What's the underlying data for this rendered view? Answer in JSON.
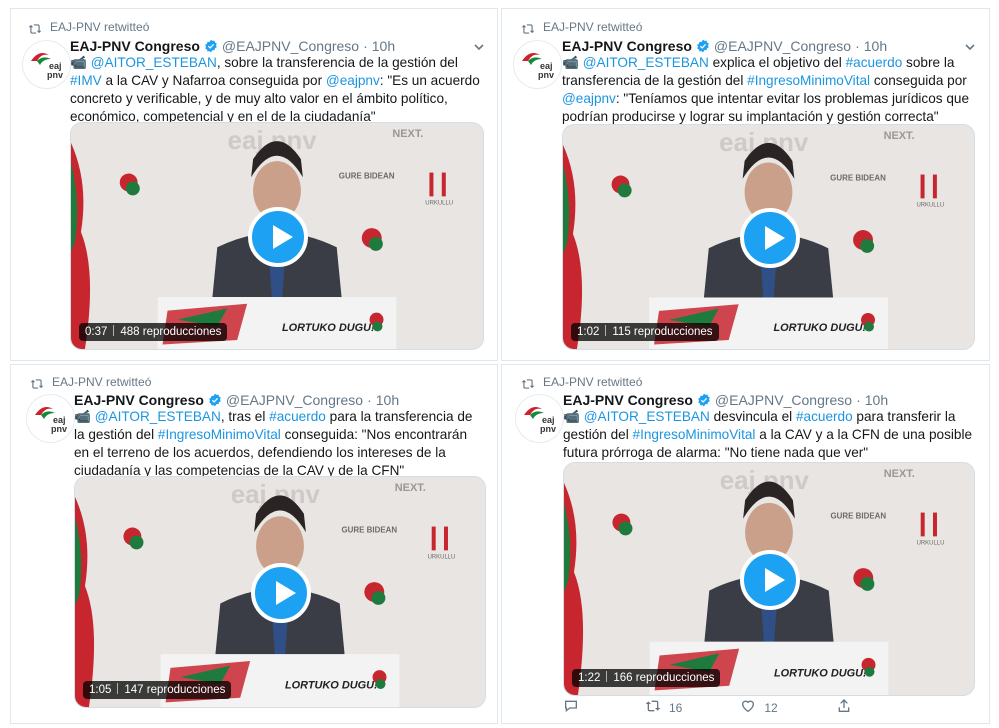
{
  "tweets": [
    {
      "retweeted_by": "EAJ-PNV retwitteó",
      "author": {
        "name": "EAJ-PNV Congreso",
        "handle": "@EAJPNV_Congreso",
        "time": "10h"
      },
      "text": [
        {
          "t": "📹 ",
          "link": false
        },
        {
          "t": "@AITOR_ESTEBAN",
          "link": true
        },
        {
          "t": ", sobre la transferencia de la gestión del ",
          "link": false
        },
        {
          "t": "#IMV",
          "link": true
        },
        {
          "t": " a la CAV y Nafarroa conseguida por ",
          "link": false
        },
        {
          "t": "@eajpnv",
          "link": true
        },
        {
          "t": ": \"Es un acuerdo concreto y verificable, y de muy alto valor en el ámbito político, económico, competencial y en el de la ciudadanía\"",
          "link": false
        }
      ],
      "video": {
        "duration": "0:37",
        "views": "488 reproducciones"
      }
    },
    {
      "retweeted_by": "EAJ-PNV retwitteó",
      "author": {
        "name": "EAJ-PNV Congreso",
        "handle": "@EAJPNV_Congreso",
        "time": "10h"
      },
      "text": [
        {
          "t": "📹 ",
          "link": false
        },
        {
          "t": "@AITOR_ESTEBAN",
          "link": true
        },
        {
          "t": " explica el objetivo del ",
          "link": false
        },
        {
          "t": "#acuerdo",
          "link": true
        },
        {
          "t": " sobre la transferencia de la gestión del ",
          "link": false
        },
        {
          "t": "#IngresoMinimoVital",
          "link": true
        },
        {
          "t": " conseguida por ",
          "link": false
        },
        {
          "t": "@eajpnv",
          "link": true
        },
        {
          "t": ": \"Teníamos que intentar evitar los problemas jurídicos que podrían producirse y lograr su implantación y gestión correcta\"",
          "link": false
        }
      ],
      "video": {
        "duration": "1:02",
        "views": "115 reproducciones"
      }
    },
    {
      "retweeted_by": "EAJ-PNV retwitteó",
      "author": {
        "name": "EAJ-PNV Congreso",
        "handle": "@EAJPNV_Congreso",
        "time": "10h"
      },
      "text": [
        {
          "t": "📹 ",
          "link": false
        },
        {
          "t": "@AITOR_ESTEBAN",
          "link": true
        },
        {
          "t": ", tras el ",
          "link": false
        },
        {
          "t": "#acuerdo",
          "link": true
        },
        {
          "t": " para la transferencia de la gestión del ",
          "link": false
        },
        {
          "t": "#IngresoMinimoVital",
          "link": true
        },
        {
          "t": " conseguida: \"Nos encontrarán en el terreno de los acuerdos, defendiendo los intereses de la ciudadanía y las competencias de la CAV y de la CFN\"",
          "link": false
        }
      ],
      "video": {
        "duration": "1:05",
        "views": "147 reproducciones"
      }
    },
    {
      "retweeted_by": "EAJ-PNV retwitteó",
      "author": {
        "name": "EAJ-PNV Congreso",
        "handle": "@EAJPNV_Congreso",
        "time": "10h"
      },
      "text": [
        {
          "t": "📹 ",
          "link": false
        },
        {
          "t": "@AITOR_ESTEBAN",
          "link": true
        },
        {
          "t": " desvincula el ",
          "link": false
        },
        {
          "t": "#acuerdo",
          "link": true
        },
        {
          "t": " para transferir la gestión del ",
          "link": false
        },
        {
          "t": "#IngresoMinimoVital",
          "link": true
        },
        {
          "t": " a la CAV y a la CFN de una posible futura prórroga de alarma: \"No tiene nada que ver\"",
          "link": false
        }
      ],
      "video": {
        "duration": "1:22",
        "views": "166 reproducciones"
      },
      "actions": {
        "retweets": "16",
        "likes": "12"
      }
    }
  ],
  "icons": {
    "retweet": "retweet-icon",
    "verified": "verified-badge-icon",
    "caret": "chevron-down-icon",
    "reply": "reply-icon",
    "like": "heart-icon",
    "share": "share-icon"
  },
  "colors": {
    "link": "#1b95e0",
    "brand": "#1da1f2",
    "muted": "#657786",
    "party_red": "#d0202e",
    "party_green": "#138a3c"
  },
  "video_overlay_text": {
    "logo": "eaj pnv",
    "next": "NEXT.",
    "gure": "GURE BIDEAN",
    "urkullu": "URKULLU",
    "slogan": "LORTUKO DUGU!"
  }
}
